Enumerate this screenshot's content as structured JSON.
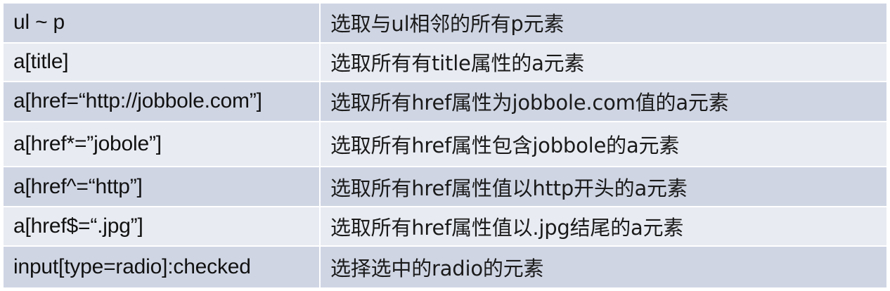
{
  "rows": [
    {
      "selector": "ul ~ p",
      "description": "选取与ul相邻的所有p元素"
    },
    {
      "selector": "a[title]",
      "description": "选取所有有title属性的a元素"
    },
    {
      "selector": "a[href=“http://jobbole.com”]",
      "description": "选取所有href属性为jobbole.com值的a元素"
    },
    {
      "selector": "a[href*=”jobole”]",
      "description": "选取所有href属性包含jobbole的a元素"
    },
    {
      "selector": "a[href^=“http”]",
      "description": "选取所有href属性值以http开头的a元素"
    },
    {
      "selector": "a[href$=“.jpg”]",
      "description": "选取所有href属性值以.jpg结尾的a元素"
    },
    {
      "selector": "input[type=radio]:checked",
      "description": "选择选中的radio的元素"
    }
  ],
  "colors": {
    "row_dark": "#cfd5e3",
    "row_light": "#e8ebf2",
    "text": "#111111"
  }
}
